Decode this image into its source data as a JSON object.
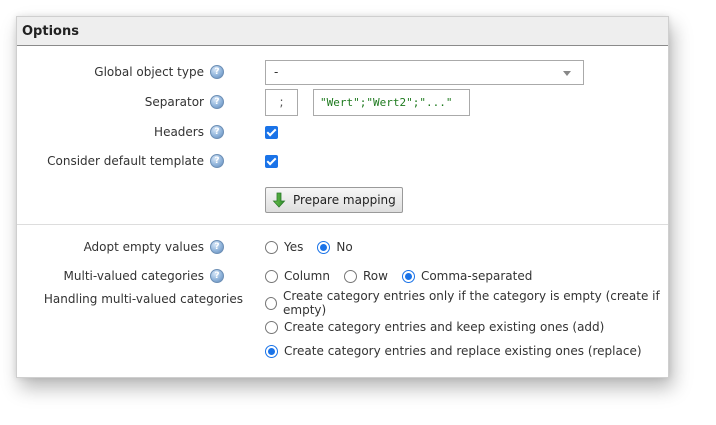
{
  "panel": {
    "title": "Options"
  },
  "global_object_type": {
    "label": "Global object type",
    "value": "-"
  },
  "separator": {
    "label": "Separator",
    "value": ";",
    "preview": "\"Wert\";\"Wert2\";\"...\""
  },
  "headers": {
    "label": "Headers",
    "checked": true
  },
  "default_template": {
    "label": "Consider default template",
    "checked": true
  },
  "prepare_mapping": {
    "label": "Prepare mapping",
    "icon": "arrow-down-icon"
  },
  "adopt_empty": {
    "label": "Adopt empty values",
    "options": [
      "Yes",
      "No"
    ],
    "selected": "No"
  },
  "multivalued": {
    "label": "Multi-valued categories",
    "options": [
      "Column",
      "Row",
      "Comma-separated"
    ],
    "selected": "Comma-separated"
  },
  "handling": {
    "label": "Handling multi-valued categories",
    "options": [
      "Create category entries only if the category is empty (create if empty)",
      "Create category entries and keep existing ones (add)",
      "Create category entries and replace existing ones (replace)"
    ],
    "selected": "Create category entries and replace existing ones (replace)"
  },
  "colors": {
    "accent": "#1a73e8",
    "preview_text": "#1e7a1e"
  }
}
